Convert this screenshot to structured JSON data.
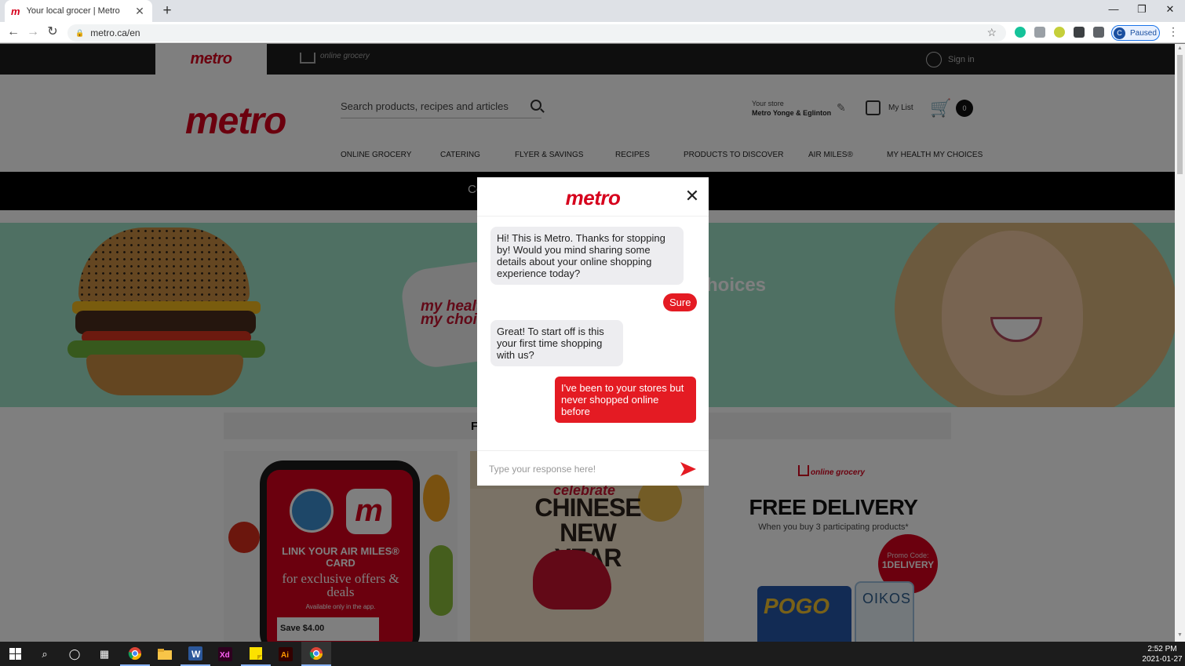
{
  "browser": {
    "tab_title": "Your local grocer | Metro",
    "tab_favicon": "m",
    "new_tab": "+",
    "url": "metro.ca/en",
    "profile_initial": "C",
    "profile_status": "Paused"
  },
  "site": {
    "topstrip_logo": "metro",
    "online_grocery_label": "online grocery",
    "signin": "Sign in",
    "logo": "metro",
    "search_placeholder": "Search products, recipes and articles",
    "store_label": "Your store",
    "store_name": "Metro Yonge & Eglinton",
    "my_list": "My List",
    "cart_count": "0",
    "nav": [
      "ONLINE GROCERY",
      "CATERING",
      "FLYER & SAVINGS",
      "RECIPES",
      "PRODUCTS TO DISCOVER",
      "AIR MILES®",
      "MY HEALTH MY CHOICES"
    ],
    "promo_bar_text": "Co",
    "hero_badge_line1": "my healt",
    "hero_badge_line2": "my choic",
    "hero_headline": "hoices",
    "section_title": "F",
    "cards": {
      "airmiles_title": "LINK YOUR AIR MILES® CARD",
      "airmiles_sub": "for exclusive offers & deals",
      "airmiles_note": "Available only in the app.",
      "airmiles_save": "Save $4.00",
      "cny_celebrate": "celebrate",
      "cny_title": "CHINESE NEW YEAR",
      "delivery_brand": "online grocery",
      "delivery_title": "FREE DELIVERY",
      "delivery_sub": "When you buy 3 participating products*",
      "promo_label": "Promo Code:",
      "promo_code": "1DELIVERY",
      "product1": "POGO",
      "product2": "OIKOS"
    }
  },
  "chat": {
    "logo": "metro",
    "messages": [
      {
        "from": "bot",
        "text": "Hi! This is Metro. Thanks for stopping by! Would you mind sharing some details about your online shopping experience today?"
      },
      {
        "from": "user",
        "text": "Sure"
      },
      {
        "from": "bot",
        "text": "Great! To start off is this your first time shopping with us?"
      },
      {
        "from": "user",
        "text": "I've been to your stores but never shopped online before"
      }
    ],
    "input_placeholder": "Type your response here!"
  },
  "taskbar": {
    "time": "2:52 PM",
    "date": "2021-01-27"
  },
  "colors": {
    "brand_red": "#d6001c",
    "bubble_red": "#e41b23",
    "bubble_gray": "#ededf0"
  }
}
